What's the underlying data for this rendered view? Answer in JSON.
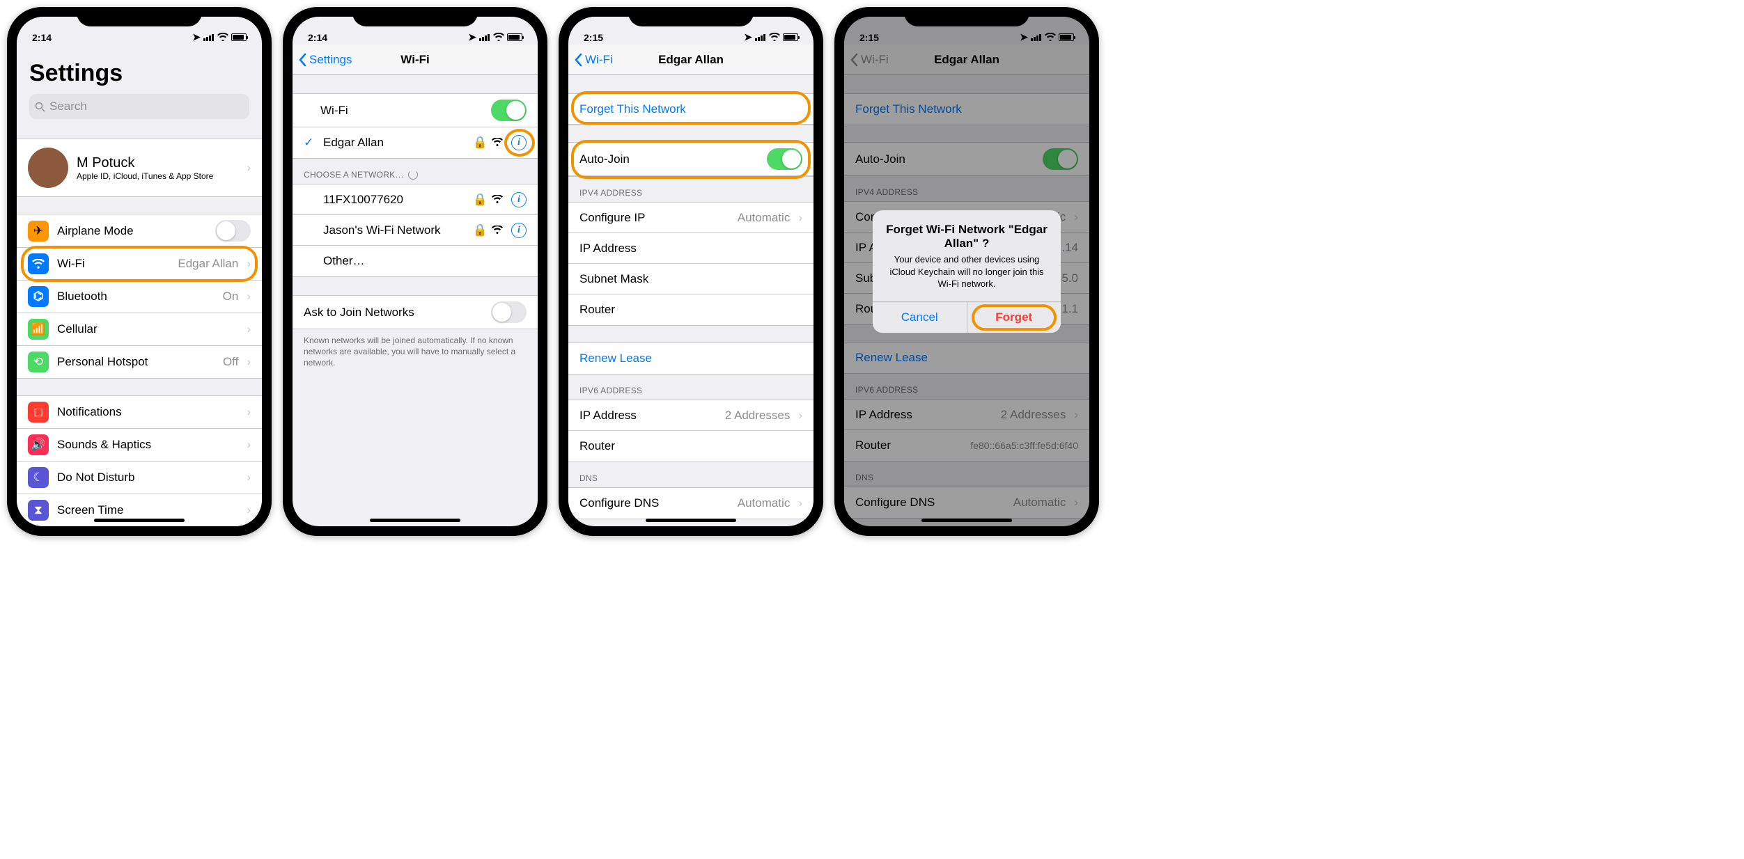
{
  "screens": [
    {
      "time": "2:14",
      "title": "Settings",
      "search_placeholder": "Search",
      "profile": {
        "name": "M Potuck",
        "subtitle": "Apple ID, iCloud, iTunes & App Store"
      },
      "items1": [
        {
          "icon": "airplane",
          "bg": "#ff9500",
          "label": "Airplane Mode",
          "toggle": false
        },
        {
          "icon": "wifi",
          "bg": "#007aff",
          "label": "Wi-Fi",
          "value": "Edgar Allan",
          "chevron": true,
          "hl": true
        },
        {
          "icon": "bluetooth",
          "bg": "#007aff",
          "label": "Bluetooth",
          "value": "On",
          "chevron": true
        },
        {
          "icon": "cellular",
          "bg": "#4cd964",
          "label": "Cellular",
          "chevron": true
        },
        {
          "icon": "hotspot",
          "bg": "#4cd964",
          "label": "Personal Hotspot",
          "value": "Off",
          "chevron": true
        }
      ],
      "items2": [
        {
          "icon": "notif",
          "bg": "#ff3b30",
          "label": "Notifications",
          "chevron": true
        },
        {
          "icon": "sounds",
          "bg": "#ff2d55",
          "label": "Sounds & Haptics",
          "chevron": true
        },
        {
          "icon": "dnd",
          "bg": "#5856d6",
          "label": "Do Not Disturb",
          "chevron": true
        },
        {
          "icon": "screentime",
          "bg": "#5856d6",
          "label": "Screen Time",
          "chevron": true
        }
      ]
    },
    {
      "time": "2:14",
      "back": "Settings",
      "title": "Wi-Fi",
      "wifi_toggle_label": "Wi-Fi",
      "connected": {
        "name": "Edgar Allan",
        "hl_info": true
      },
      "choose_header": "CHOOSE A NETWORK…",
      "networks": [
        {
          "name": "11FX10077620"
        },
        {
          "name": "Jason's Wi-Fi Network"
        }
      ],
      "other": "Other…",
      "ask_label": "Ask to Join Networks",
      "ask_footer": "Known networks will be joined automatically. If no known networks are available, you will have to manually select a network."
    },
    {
      "time": "2:15",
      "back": "Wi-Fi",
      "title": "Edgar Allan",
      "forget": "Forget This Network",
      "autojoin": "Auto-Join",
      "ipv4_header": "IPV4 ADDRESS",
      "ipv4": [
        {
          "label": "Configure IP",
          "value": "Automatic",
          "chevron": true
        },
        {
          "label": "IP Address"
        },
        {
          "label": "Subnet Mask"
        },
        {
          "label": "Router"
        }
      ],
      "renew": "Renew Lease",
      "ipv6_header": "IPV6 ADDRESS",
      "ipv6": [
        {
          "label": "IP Address",
          "value": "2 Addresses",
          "chevron": true
        },
        {
          "label": "Router"
        }
      ],
      "dns_header": "DNS",
      "dns": [
        {
          "label": "Configure DNS",
          "value": "Automatic",
          "chevron": true
        }
      ]
    },
    {
      "time": "2:15",
      "back": "Wi-Fi",
      "title": "Edgar Allan",
      "forget": "Forget This Network",
      "autojoin": "Auto-Join",
      "ipv4_header": "IPV4 ADDRESS",
      "ipv4": [
        {
          "label": "Configure IP",
          "value": "Automatic",
          "chevron": true
        },
        {
          "label": "IP Address",
          "value": "0.1.14"
        },
        {
          "label": "Subnet Mask",
          "value": "255.0"
        },
        {
          "label": "Router",
          "value": "0.1.1"
        }
      ],
      "renew": "Renew Lease",
      "ipv6_header": "IPV6 ADDRESS",
      "ipv6": [
        {
          "label": "IP Address",
          "value": "2 Addresses",
          "chevron": true
        },
        {
          "label": "Router",
          "value": "fe80::66a5:c3ff:fe5d:6f40"
        }
      ],
      "dns_header": "DNS",
      "dns": [
        {
          "label": "Configure DNS",
          "value": "Automatic",
          "chevron": true
        }
      ],
      "alert": {
        "title": "Forget Wi-Fi Network \"Edgar Allan\" ?",
        "message": "Your device and other devices using iCloud Keychain will no longer join this Wi-Fi network.",
        "cancel": "Cancel",
        "forget": "Forget"
      }
    }
  ]
}
